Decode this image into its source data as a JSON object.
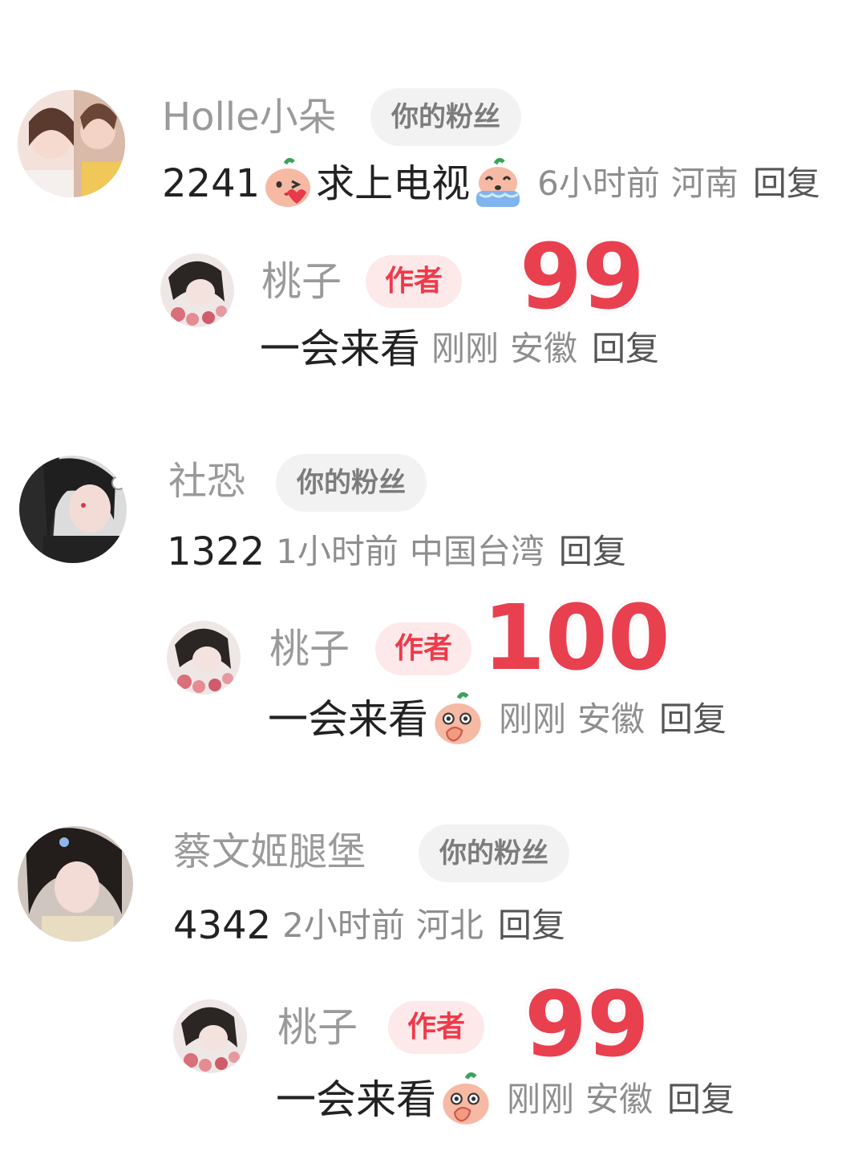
{
  "comments": [
    {
      "username": "Holle小朵",
      "fan_badge": "你的粉丝",
      "text_before": "2241",
      "emoji1": "kiss-peach-emoji",
      "text_mid": "求上电视",
      "emoji2": "crying-peach-emoji",
      "time": "6小时前",
      "location": "河南",
      "reply_label": "回复",
      "reply": {
        "username": "桃子",
        "author_badge": "作者",
        "overlay_number": "99",
        "text": "一会来看",
        "emoji": "",
        "time": "刚刚",
        "location": "安徽",
        "reply_label": "回复"
      }
    },
    {
      "username": "社恐",
      "fan_badge": "你的粉丝",
      "text_before": "1322",
      "time": "1小时前",
      "location": "中国台湾",
      "reply_label": "回复",
      "reply": {
        "username": "桃子",
        "author_badge": "作者",
        "overlay_number": "100",
        "text": "一会来看",
        "emoji": "covering-mouth-peach-emoji",
        "time": "刚刚",
        "location": "安徽",
        "reply_label": "回复"
      }
    },
    {
      "username": "蔡文姬腿堡",
      "fan_badge": "你的粉丝",
      "text_before": "4342",
      "time": "2小时前",
      "location": "河北",
      "reply_label": "回复",
      "reply": {
        "username": "桃子",
        "author_badge": "作者",
        "overlay_number": "99",
        "text": "一会来看",
        "emoji": "covering-mouth-peach-emoji",
        "time": "刚刚",
        "location": "安徽",
        "reply_label": "回复"
      }
    }
  ]
}
